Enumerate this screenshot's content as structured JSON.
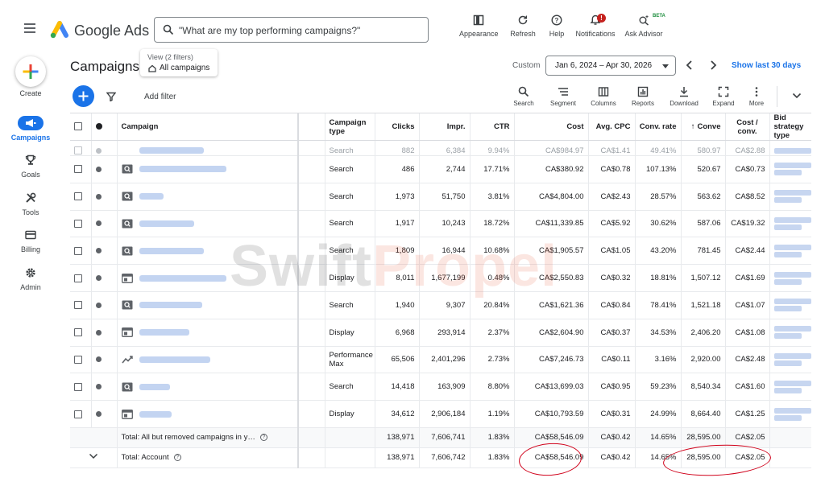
{
  "header": {
    "brand": "Google Ads",
    "search_placeholder": "\"What are my top performing campaigns?\"",
    "buttons": [
      {
        "label": "Appearance",
        "icon": "appearance-icon"
      },
      {
        "label": "Refresh",
        "icon": "refresh-icon"
      },
      {
        "label": "Help",
        "icon": "help-icon"
      },
      {
        "label": "Notifications",
        "icon": "bell-icon",
        "badge": "!"
      },
      {
        "label": "Ask Advisor",
        "icon": "sparkle-search-icon",
        "tag": "BETA"
      }
    ]
  },
  "sidenav": {
    "create_label": "Create",
    "items": [
      {
        "label": "Campaigns",
        "icon": "megaphone-icon",
        "active": true
      },
      {
        "label": "Goals",
        "icon": "trophy-icon"
      },
      {
        "label": "Tools",
        "icon": "tools-icon"
      },
      {
        "label": "Billing",
        "icon": "credit-card-icon"
      },
      {
        "label": "Admin",
        "icon": "gear-icon"
      }
    ]
  },
  "page": {
    "title": "Campaigns",
    "view_label": "View (2 filters)",
    "view_value": "All campaigns",
    "date_mode": "Custom",
    "date_range": "Jan 6, 2024 – Apr 30, 2026",
    "show_last": "Show last 30 days"
  },
  "toolbar": {
    "add_filter": "Add filter",
    "tools": [
      {
        "label": "Search",
        "icon": "search-icon"
      },
      {
        "label": "Segment",
        "icon": "segment-icon"
      },
      {
        "label": "Columns",
        "icon": "columns-icon"
      },
      {
        "label": "Reports",
        "icon": "reports-icon"
      },
      {
        "label": "Download",
        "icon": "download-icon"
      },
      {
        "label": "Expand",
        "icon": "expand-icon"
      },
      {
        "label": "More",
        "icon": "more-vert-icon"
      }
    ]
  },
  "table": {
    "columns": {
      "campaign": "Campaign",
      "type": "Campaign type",
      "clicks": "Clicks",
      "impr": "Impr.",
      "ctr": "CTR",
      "cost": "Cost",
      "avg_cpc": "Avg. CPC",
      "conv_rate": "Conv. rate",
      "conv": "Conve",
      "cost_conv": "Cost / conv.",
      "bid": "Bid strategy type"
    },
    "partial_row": {
      "type": "Search",
      "clicks": "882",
      "impr": "6,384",
      "ctr": "9.94%",
      "cost": "CA$984.97",
      "avg_cpc": "CA$1.41",
      "conv_rate": "49.41%",
      "conv": "580.97",
      "cost_conv": "CA$2.88"
    },
    "rows": [
      {
        "icon": "search-campaign-icon",
        "type": "Search",
        "clicks": "486",
        "impr": "2,744",
        "ctr": "17.71%",
        "cost": "CA$380.92",
        "avg_cpc": "CA$0.78",
        "conv_rate": "107.13%",
        "conv": "520.67",
        "cost_conv": "CA$0.73"
      },
      {
        "icon": "search-campaign-icon",
        "type": "Search",
        "clicks": "1,973",
        "impr": "51,750",
        "ctr": "3.81%",
        "cost": "CA$4,804.00",
        "avg_cpc": "CA$2.43",
        "conv_rate": "28.57%",
        "conv": "563.62",
        "cost_conv": "CA$8.52"
      },
      {
        "icon": "search-campaign-icon",
        "type": "Search",
        "clicks": "1,917",
        "impr": "10,243",
        "ctr": "18.72%",
        "cost": "CA$11,339.85",
        "avg_cpc": "CA$5.92",
        "conv_rate": "30.62%",
        "conv": "587.06",
        "cost_conv": "CA$19.32"
      },
      {
        "icon": "search-campaign-icon",
        "type": "Search",
        "clicks": "1,809",
        "impr": "16,944",
        "ctr": "10.68%",
        "cost": "CA$1,905.57",
        "avg_cpc": "CA$1.05",
        "conv_rate": "43.20%",
        "conv": "781.45",
        "cost_conv": "CA$2.44"
      },
      {
        "icon": "display-campaign-icon",
        "type": "Display",
        "clicks": "8,011",
        "impr": "1,677,199",
        "ctr": "0.48%",
        "cost": "CA$2,550.83",
        "avg_cpc": "CA$0.32",
        "conv_rate": "18.81%",
        "conv": "1,507.12",
        "cost_conv": "CA$1.69"
      },
      {
        "icon": "search-campaign-icon",
        "type": "Search",
        "clicks": "1,940",
        "impr": "9,307",
        "ctr": "20.84%",
        "cost": "CA$1,621.36",
        "avg_cpc": "CA$0.84",
        "conv_rate": "78.41%",
        "conv": "1,521.18",
        "cost_conv": "CA$1.07"
      },
      {
        "icon": "display-campaign-icon",
        "type": "Display",
        "clicks": "6,968",
        "impr": "293,914",
        "ctr": "2.37%",
        "cost": "CA$2,604.90",
        "avg_cpc": "CA$0.37",
        "conv_rate": "34.53%",
        "conv": "2,406.20",
        "cost_conv": "CA$1.08"
      },
      {
        "icon": "pmax-campaign-icon",
        "type": "Performance Max",
        "clicks": "65,506",
        "impr": "2,401,296",
        "ctr": "2.73%",
        "cost": "CA$7,246.73",
        "avg_cpc": "CA$0.11",
        "conv_rate": "3.16%",
        "conv": "2,920.00",
        "cost_conv": "CA$2.48"
      },
      {
        "icon": "search-campaign-icon",
        "type": "Search",
        "clicks": "14,418",
        "impr": "163,909",
        "ctr": "8.80%",
        "cost": "CA$13,699.03",
        "avg_cpc": "CA$0.95",
        "conv_rate": "59.23%",
        "conv": "8,540.34",
        "cost_conv": "CA$1.60"
      },
      {
        "icon": "display-campaign-icon",
        "type": "Display",
        "clicks": "34,612",
        "impr": "2,906,184",
        "ctr": "1.19%",
        "cost": "CA$10,793.59",
        "avg_cpc": "CA$0.31",
        "conv_rate": "24.99%",
        "conv": "8,664.40",
        "cost_conv": "CA$1.25"
      }
    ],
    "total_removed": {
      "label": "Total: All but removed campaigns in y…",
      "clicks": "138,971",
      "impr": "7,606,741",
      "ctr": "1.83%",
      "cost": "CA$58,546.09",
      "avg_cpc": "CA$0.42",
      "conv_rate": "14.65%",
      "conv": "28,595.00",
      "cost_conv": "CA$2.05"
    },
    "total_account": {
      "label": "Total: Account",
      "clicks": "138,971",
      "impr": "7,606,742",
      "ctr": "1.83%",
      "cost": "CA$58,546.09",
      "avg_cpc": "CA$0.42",
      "conv_rate": "14.65%",
      "conv": "28,595.00",
      "cost_conv": "CA$2.05"
    }
  },
  "watermark": {
    "part1": "Swift",
    "part2": "Propel"
  },
  "colors": {
    "accent": "#1a73e8",
    "annotation": "#d0021b",
    "watermark_orange": "#e8431f"
  }
}
